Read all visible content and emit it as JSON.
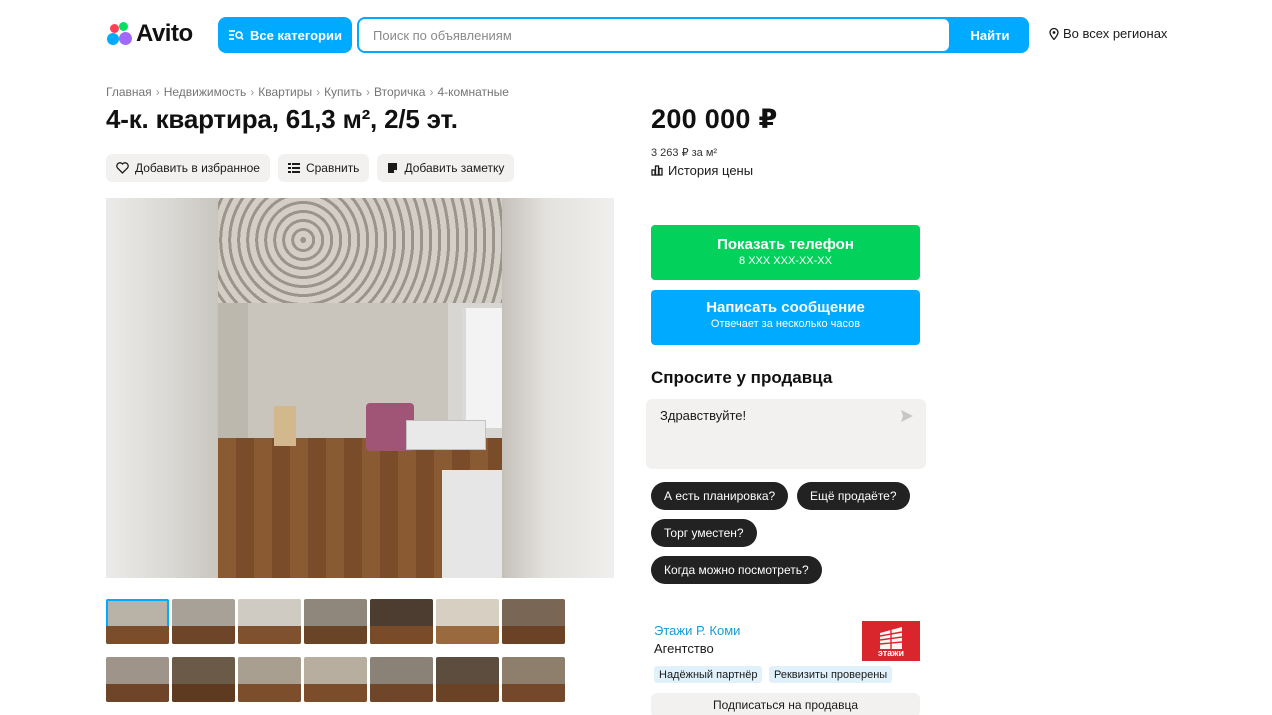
{
  "header": {
    "logo_text": "Avito",
    "categories_label": "Все категории",
    "search_placeholder": "Поиск по объявлениям",
    "search_value": "",
    "search_button": "Найти",
    "region": "Во всех регионах"
  },
  "breadcrumb": [
    "Главная",
    "Недвижимость",
    "Квартиры",
    "Купить",
    "Вторичка",
    "4-комнатные"
  ],
  "listing": {
    "title": "4-к. квартира, 61,3 м², 2/5 эт.",
    "actions": {
      "favorite": "Добавить в избранное",
      "compare": "Сравнить",
      "note": "Добавить заметку"
    },
    "price": "200 000 ₽",
    "price_per_m2": "3 263 ₽ за м²",
    "price_history": "История цены",
    "thumbnail_count": 14
  },
  "contact": {
    "phone_label": "Показать телефон",
    "phone_masked": "8 XXX XXX-XX-XX",
    "message_label": "Написать сообщение",
    "message_sub": "Отвечает за несколько часов"
  },
  "ask": {
    "title": "Спросите у продавца",
    "message_value": "Здравствуйте!",
    "chips": [
      "А есть планировка?",
      "Ещё продаёте?",
      "Торг уместен?",
      "Когда можно посмотреть?"
    ]
  },
  "seller": {
    "name": "Этажи Р. Коми",
    "type": "Агентство",
    "logo_text": "этажи",
    "badges": [
      "Надёжный партнёр",
      "Реквизиты проверены"
    ],
    "subscribe": "Подписаться на продавца"
  },
  "colors": {
    "brand_blue": "#00aaff",
    "phone_green": "#02d15c",
    "chip_dark": "#222222",
    "seller_red": "#d9262c"
  }
}
